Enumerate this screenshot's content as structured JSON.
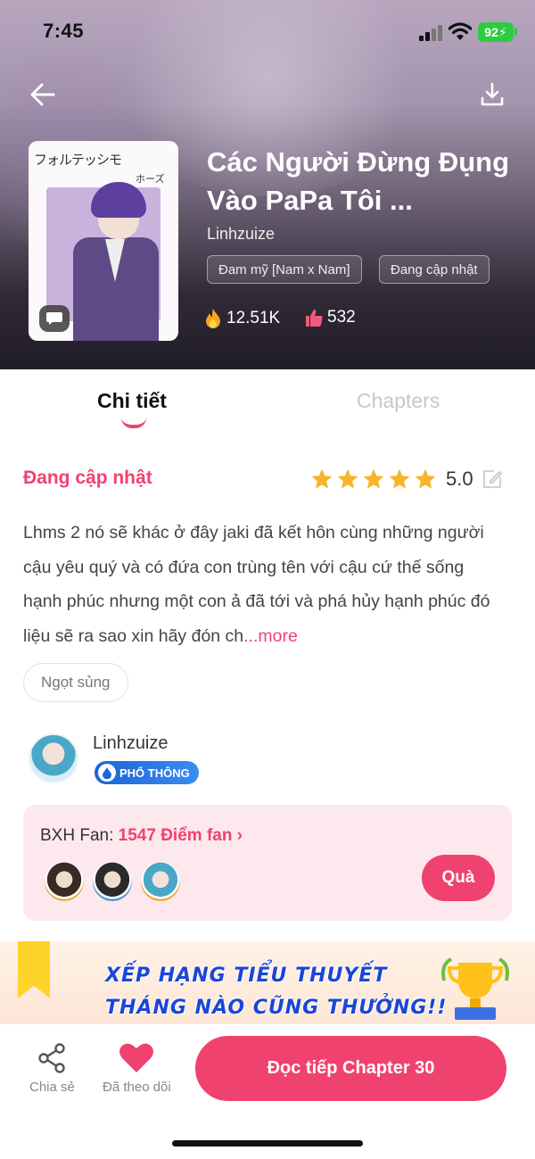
{
  "status_bar": {
    "time": "7:45",
    "battery": "92"
  },
  "header": {
    "title": "Các Người Đừng Đụng Vào PaPa Tôi ...",
    "author": "Linhzuize",
    "tags": [
      "Đam mỹ [Nam x Nam]",
      "Đang cập nhật"
    ],
    "views": "12.51K",
    "likes": "532",
    "cover": {
      "text_main": "フォルテッシモ",
      "text_sub": "ホーズ"
    }
  },
  "tabs": [
    {
      "label": "Chi tiết",
      "active": true
    },
    {
      "label": "Chapters",
      "active": false
    }
  ],
  "detail": {
    "status": "Đang cập nhật",
    "rating": "5.0",
    "stars": 5,
    "description": "Lhms 2 nó sẽ khác ở đây jaki đã kết hôn cùng những người cậu yêu quý và có đứa con trùng tên với cậu cứ thế sống hạnh phúc nhưng một con ả đã tới và phá hủy hạnh phúc đó liệu sẽ ra sao xin hãy đón ch",
    "more_label": "...more",
    "genre": "Ngọt sủng"
  },
  "author_card": {
    "name": "Linhzuize",
    "rank": "PHỔ THÔNG"
  },
  "fan": {
    "label": "BXH Fan: ",
    "points": "1547 Điểm fan",
    "gift_label": "Quà"
  },
  "banner": {
    "line1": "XẾP HẠNG TIỂU THUYẾT",
    "line2": "THÁNG NÀO CŨNG THƯỞNG!!"
  },
  "bottom": {
    "share_label": "Chia sẻ",
    "follow_label": "Đã theo dõi",
    "read_label": "Đọc tiếp Chapter 30"
  },
  "colors": {
    "accent": "#f0426f",
    "star": "#f7b52b",
    "badge_blue": "#1b64d8"
  }
}
